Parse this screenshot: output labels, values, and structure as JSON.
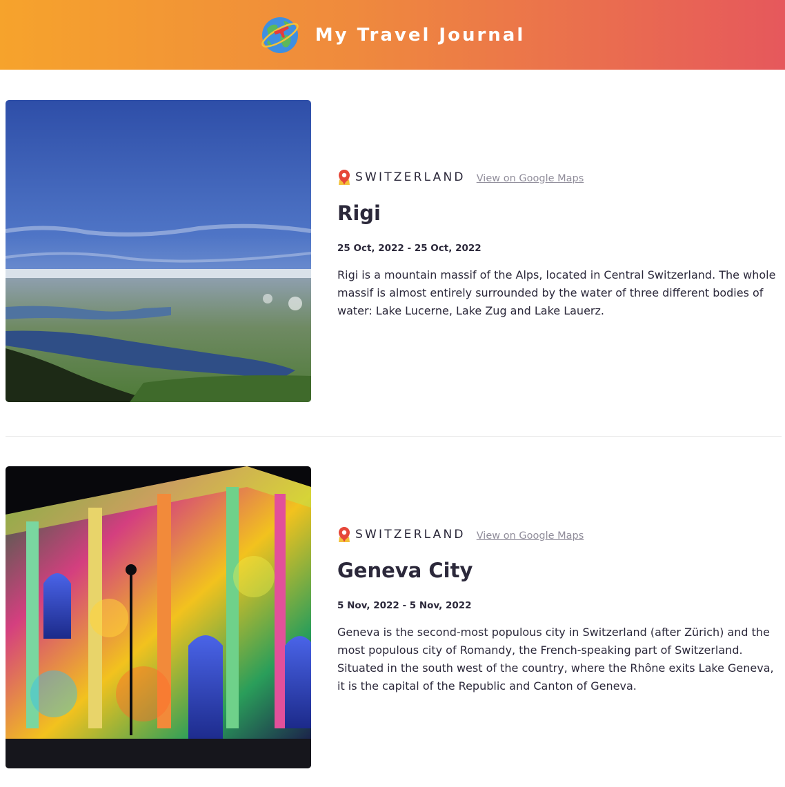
{
  "header": {
    "title": "My Travel Journal",
    "logo_icon": "globe-icon"
  },
  "entries": [
    {
      "country": "SWITZERLAND",
      "maps_link": "View on Google Maps",
      "title": "Rigi",
      "dates": "25 Oct, 2022 - 25 Oct, 2022",
      "description": "Rigi is a mountain massif of the Alps, located in Central Switzerland. The whole massif is almost entirely surrounded by the water of three different bodies of water: Lake Lucerne, Lake Zug and Lake Lauerz.",
      "photo_icon": "mountain-lake-photo"
    },
    {
      "country": "SWITZERLAND",
      "maps_link": "View on Google Maps",
      "title": "Geneva City",
      "dates": "5 Nov, 2022 - 5 Nov, 2022",
      "description": "Geneva is the second-most populous city in Switzerland (after Zürich) and the most populous city of Romandy, the French-speaking part of Switzerland. Situated in the south west of the country, where the Rhône exits Lake Geneva, it is the capital of the Republic and Canton of Geneva.",
      "photo_icon": "illuminated-building-photo"
    }
  ],
  "colors": {
    "header_gradient_start": "#f6a32c",
    "header_gradient_end": "#e6585c",
    "text_primary": "#2b283a",
    "link_gray": "#918e9b"
  }
}
